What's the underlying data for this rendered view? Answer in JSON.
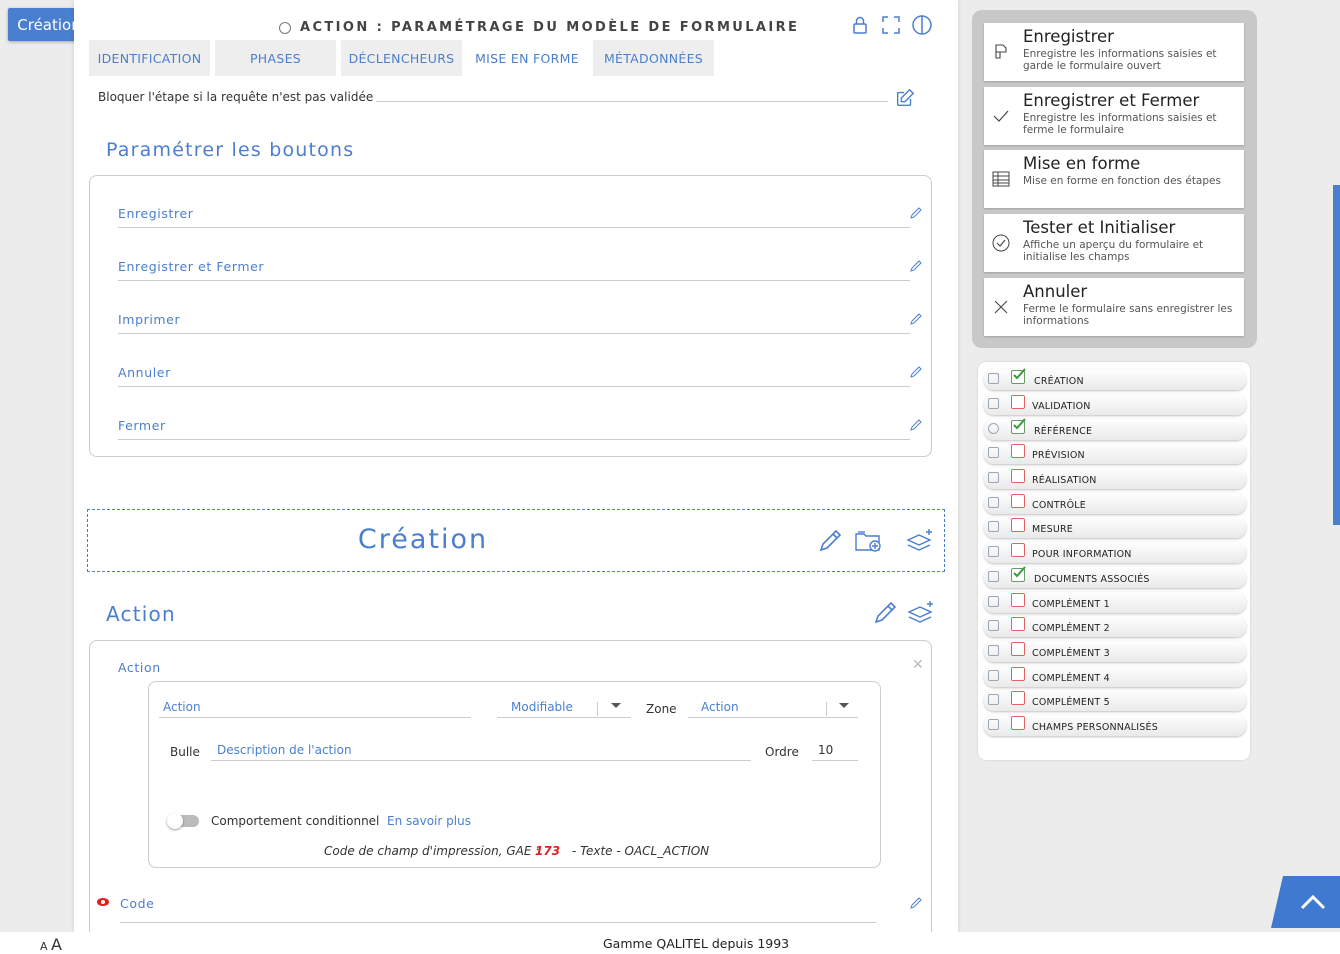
{
  "badge": "Création",
  "header": {
    "title": "ACTION : PARAMÉTRAGE DU MODÈLE DE FORMULAIRE"
  },
  "tabs": [
    {
      "label": "IDENTIFICATION"
    },
    {
      "label": "PHASES"
    },
    {
      "label": "DÉCLENCHEURS"
    },
    {
      "label": "MISE EN FORME"
    },
    {
      "label": "MÉTADONNÉES"
    }
  ],
  "block_label": "Bloquer l'étape si la requête n'est pas validée",
  "buttons_section": {
    "title": "Paramétrer les boutons",
    "items": [
      "Enregistrer",
      "Enregistrer et Fermer",
      "Imprimer",
      "Annuler",
      "Fermer"
    ]
  },
  "phase_title": "Création",
  "action_section": {
    "title": "Action",
    "panel_label": "Action",
    "name_placeholder": "Action",
    "mode_value": "Modifiable",
    "zone_label": "Zone",
    "zone_value": "Action",
    "bulle_label": "Bulle",
    "bulle_placeholder": "Description de l'action",
    "ordre_label": "Ordre",
    "ordre_value": "10",
    "conditional_label": "Comportement conditionnel",
    "learn_more": "En savoir plus",
    "print_code_prefix": "Code de champ d'impression, GAE :",
    "print_code_number": "173",
    "print_code_suffix": "- Texte - OACL_ACTION"
  },
  "code_label": "Code",
  "footer": {
    "small_a": "A",
    "big_a": "A",
    "text": "Gamme QALITEL depuis 1993"
  },
  "side_buttons": [
    {
      "title": "Enregistrer",
      "subtitle": "Enregistre les informations saisies et garde le formulaire ouvert",
      "icon": "save-icon"
    },
    {
      "title": "Enregistrer et Fermer",
      "subtitle": "Enregistre les informations saisies et ferme le formulaire",
      "icon": "check-icon"
    },
    {
      "title": "Mise en forme",
      "subtitle": "Mise en forme en fonction des étapes",
      "icon": "table-icon"
    },
    {
      "title": "Tester et Initialiser",
      "subtitle": "Affiche un aperçu du formulaire et initialise les champs",
      "icon": "circle-check-icon"
    },
    {
      "title": "Annuler",
      "subtitle": "Ferme le formulaire sans enregistrer les informations",
      "icon": "close-icon"
    }
  ],
  "phases": [
    {
      "label": "CRÉATION",
      "checked": true
    },
    {
      "label": "VALIDATION",
      "checked": false
    },
    {
      "label": "RÉFÉRENCE",
      "checked": true
    },
    {
      "label": "PRÉVISION",
      "checked": false
    },
    {
      "label": "RÉALISATION",
      "checked": false
    },
    {
      "label": "CONTRÔLE",
      "checked": false
    },
    {
      "label": "MESURE",
      "checked": false
    },
    {
      "label": "POUR INFORMATION",
      "checked": false
    },
    {
      "label": "DOCUMENTS ASSOCIÉS",
      "checked": true
    },
    {
      "label": "COMPLÉMENT 1",
      "checked": false
    },
    {
      "label": "COMPLÉMENT 2",
      "checked": false
    },
    {
      "label": "COMPLÉMENT 3",
      "checked": false
    },
    {
      "label": "COMPLÉMENT 4",
      "checked": false
    },
    {
      "label": "COMPLÉMENT 5",
      "checked": false
    },
    {
      "label": "CHAMPS PERSONNALISÉS",
      "checked": false
    }
  ],
  "colors": {
    "accent": "#4a7fcf",
    "checked": "#3a9a3a",
    "unchecked": "#e26262",
    "code_number": "#e02020"
  }
}
